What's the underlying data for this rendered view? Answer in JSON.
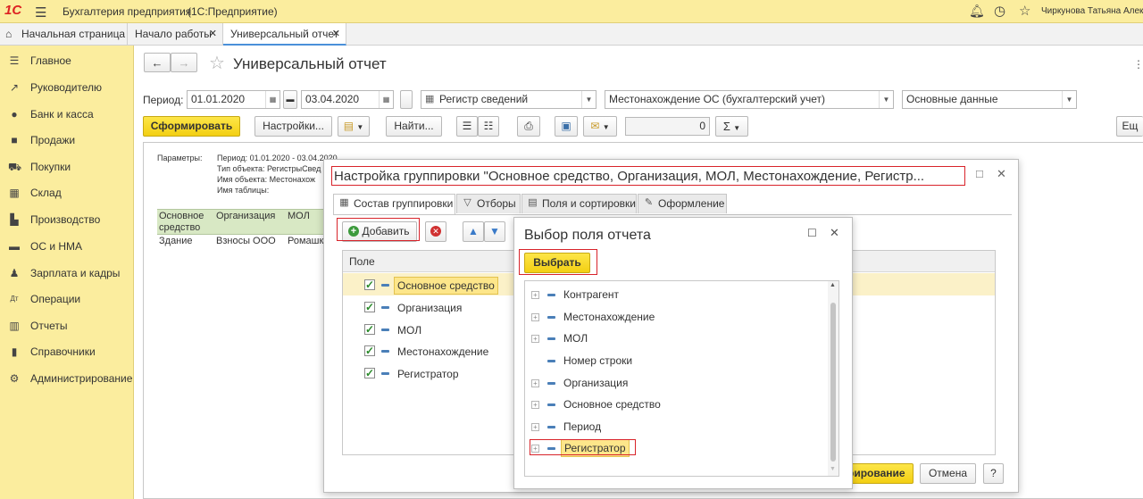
{
  "app": {
    "logo": "1С",
    "title": "Бухгалтерия предприятия",
    "subtitle": "(1С:Предприятие)",
    "user": "Чиркунова Татьяна Алекс"
  },
  "tabs": [
    {
      "label": "Начальная страница"
    },
    {
      "label": "Начало работы"
    },
    {
      "label": "Универсальный отчет"
    }
  ],
  "sidebar": {
    "items": [
      {
        "label": "Главное",
        "icon": "menu-icon"
      },
      {
        "label": "Руководителю",
        "icon": "chart-icon"
      },
      {
        "label": "Банк и касса",
        "icon": "coin-icon"
      },
      {
        "label": "Продажи",
        "icon": "bag-icon"
      },
      {
        "label": "Покупки",
        "icon": "cart-icon"
      },
      {
        "label": "Склад",
        "icon": "warehouse-icon"
      },
      {
        "label": "Производство",
        "icon": "factory-icon"
      },
      {
        "label": "ОС и НМА",
        "icon": "truck-icon"
      },
      {
        "label": "Зарплата и кадры",
        "icon": "person-icon"
      },
      {
        "label": "Операции",
        "icon": "operations-icon"
      },
      {
        "label": "Отчеты",
        "icon": "reports-icon"
      },
      {
        "label": "Справочники",
        "icon": "book-icon"
      },
      {
        "label": "Администрирование",
        "icon": "gear-icon"
      }
    ]
  },
  "report": {
    "title": "Универсальный отчет",
    "period_label": "Период:",
    "date_from": "01.01.2020",
    "date_sep": "–",
    "date_to": "03.04.2020",
    "object_type": "Регистр сведений",
    "object_name": "Местонахождение ОС (бухгалтерский учет)",
    "table_name": "Основные данные",
    "generate_btn": "Сформировать",
    "settings_btn": "Настройки...",
    "find_btn": "Найти...",
    "sum_value": "0",
    "more_btn": "Ещ",
    "params_label": "Параметры:",
    "params": [
      "Период: 01.01.2020 - 03.04.2020",
      "Тип объекта: РегистрыСвед",
      "Имя объекта: Местонахож",
      "Имя таблицы:"
    ],
    "columns": [
      "Основное средство",
      "Организация",
      "МОЛ"
    ],
    "rows": [
      [
        "Здание",
        "Взносы ООО",
        "Ромашки"
      ]
    ]
  },
  "grouping_dialog": {
    "title": "Настройка группировки \"Основное средство, Организация, МОЛ, Местонахождение, Регистр...",
    "tabs": [
      "Состав группировки",
      "Отборы",
      "Поля и сортировки",
      "Оформление"
    ],
    "add_btn": "Добавить",
    "column_header": "Поле",
    "fields": [
      "Основное средство",
      "Организация",
      "МОЛ",
      "Местонахождение",
      "Регистратор"
    ],
    "ok_btn_partial": "рирование",
    "cancel_btn": "Отмена",
    "help_btn": "?"
  },
  "select_dialog": {
    "title": "Выбор поля отчета",
    "select_btn": "Выбрать",
    "items": [
      {
        "label": "Контрагент",
        "expandable": true
      },
      {
        "label": "Местонахождение",
        "expandable": true
      },
      {
        "label": "МОЛ",
        "expandable": true
      },
      {
        "label": "Номер строки",
        "expandable": false
      },
      {
        "label": "Организация",
        "expandable": true
      },
      {
        "label": "Основное средство",
        "expandable": true
      },
      {
        "label": "Период",
        "expandable": true
      },
      {
        "label": "Регистратор",
        "expandable": true
      }
    ]
  },
  "colors": {
    "accent_yellow": "#f3cf13",
    "header_bg": "#fbed9e",
    "highlight": "#d8232a"
  }
}
